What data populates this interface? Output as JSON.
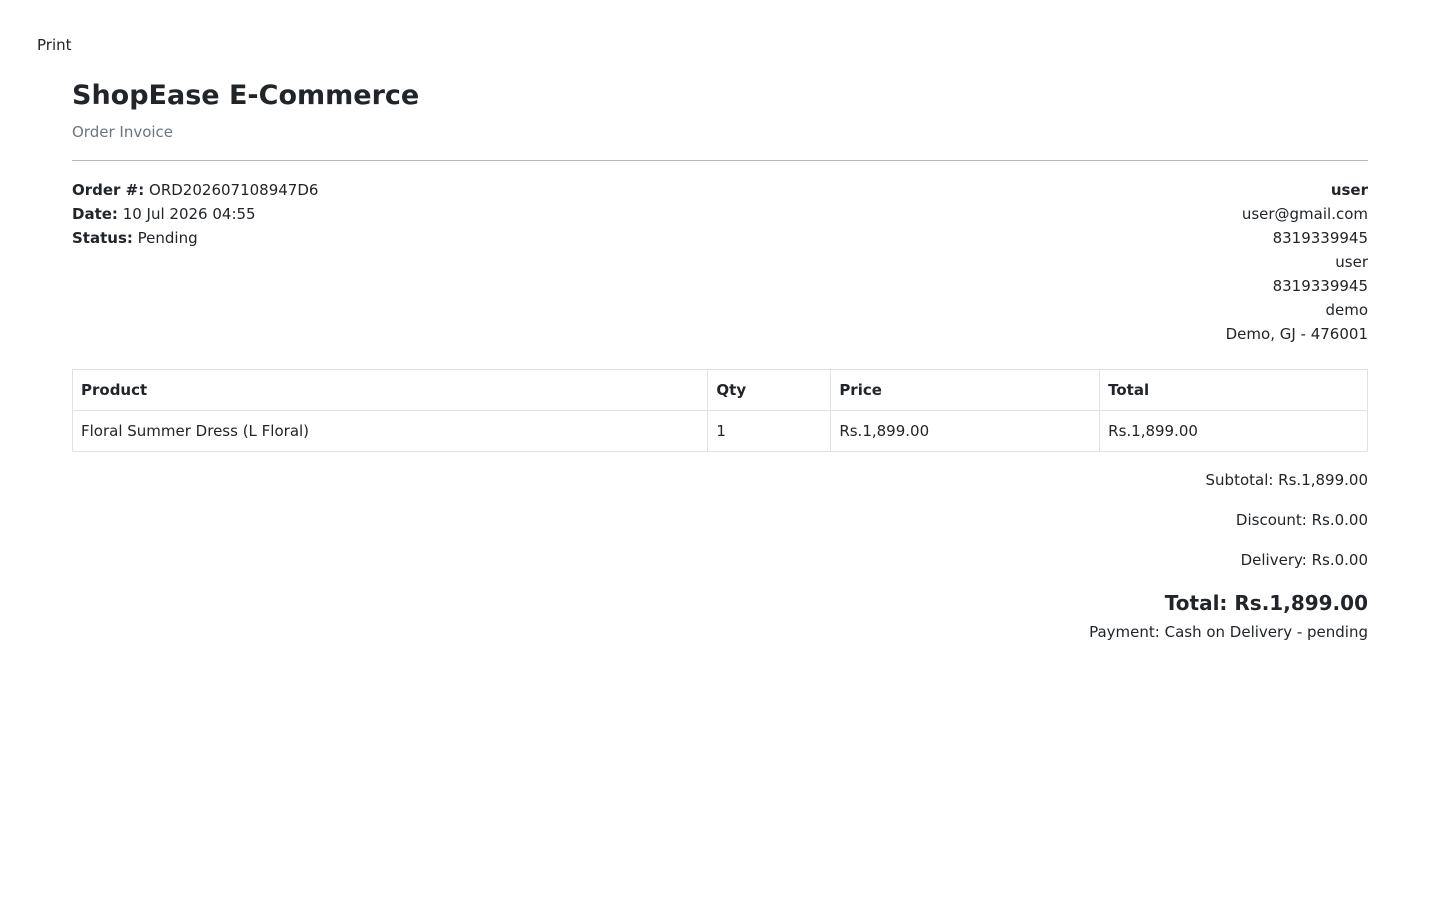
{
  "toolbar": {
    "print_label": "Print"
  },
  "header": {
    "shop_name": "ShopEase E-Commerce",
    "subtitle": "Order Invoice"
  },
  "order": {
    "number_label": "Order #:",
    "number": "ORD202607108947D6",
    "date_label": "Date:",
    "date": "10 Jul 2026 04:55",
    "status_label": "Status:",
    "status": "Pending"
  },
  "customer": {
    "name": "user",
    "email": "user@gmail.com",
    "phone": "8319339945",
    "ship_name": "user",
    "ship_phone": "8319339945",
    "address_line": "demo",
    "city_line": "Demo, GJ - 476001"
  },
  "table": {
    "headers": [
      "Product",
      "Qty",
      "Price",
      "Total"
    ],
    "rows": [
      {
        "product": "Floral Summer Dress (L Floral)",
        "qty": "1",
        "price": "Rs.1,899.00",
        "total": "Rs.1,899.00"
      }
    ]
  },
  "totals": {
    "subtotal": "Subtotal: Rs.1,899.00",
    "discount": "Discount: Rs.0.00",
    "delivery": "Delivery: Rs.0.00",
    "grand_total": "Total: Rs.1,899.00",
    "payment": "Payment: Cash on Delivery - pending"
  },
  "colors": {
    "text": "#212529",
    "muted": "#6c757d",
    "border": "#dee2e6"
  }
}
